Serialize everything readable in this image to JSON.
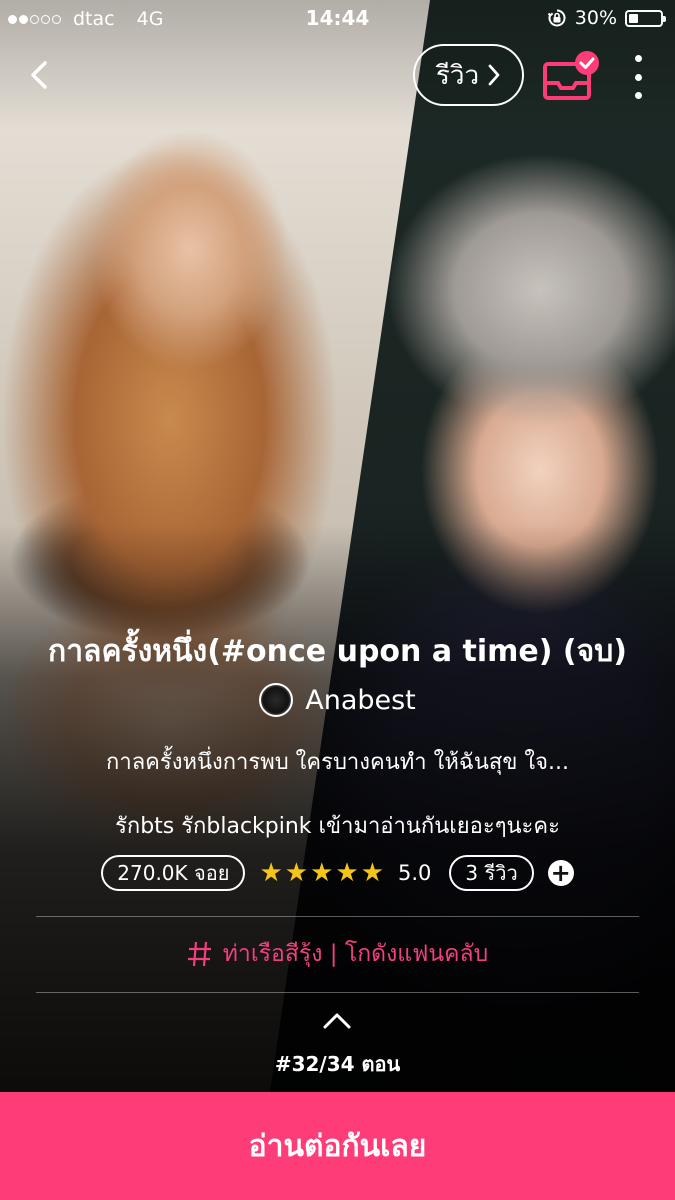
{
  "status_bar": {
    "carrier": "dtac",
    "network": "4G",
    "time": "14:44",
    "battery": "30%",
    "battery_level": 0.3
  },
  "header": {
    "review_label": "รีวิว",
    "icons": [
      "back-icon",
      "chevron-right-icon",
      "bookshelf-check-icon",
      "more-vertical-icon"
    ],
    "accent_color": "#fe3c78"
  },
  "story": {
    "title": "กาลครั้งหนึ่ง(#once upon a time) (จบ)",
    "author": "Anabest",
    "summary": "กาลครั้งหนึ่งการพบ ใครบางคนทำ ให้ฉันสุข ใจ...",
    "tagline": "รักbts รักblackpink เข้ามาอ่านกันเยอะๆนะคะ",
    "views": "270.0K จอย",
    "star_count": 5,
    "rating": "5.0",
    "reviews": "3 รีวิว",
    "add_symbol": "+",
    "tags": "ท่าเรือสีรุ้ง | โกดังแฟนคลับ",
    "chapter": "#32/34 ตอน"
  },
  "footer": {
    "read_button": "อ่านต่อกันเลย"
  }
}
